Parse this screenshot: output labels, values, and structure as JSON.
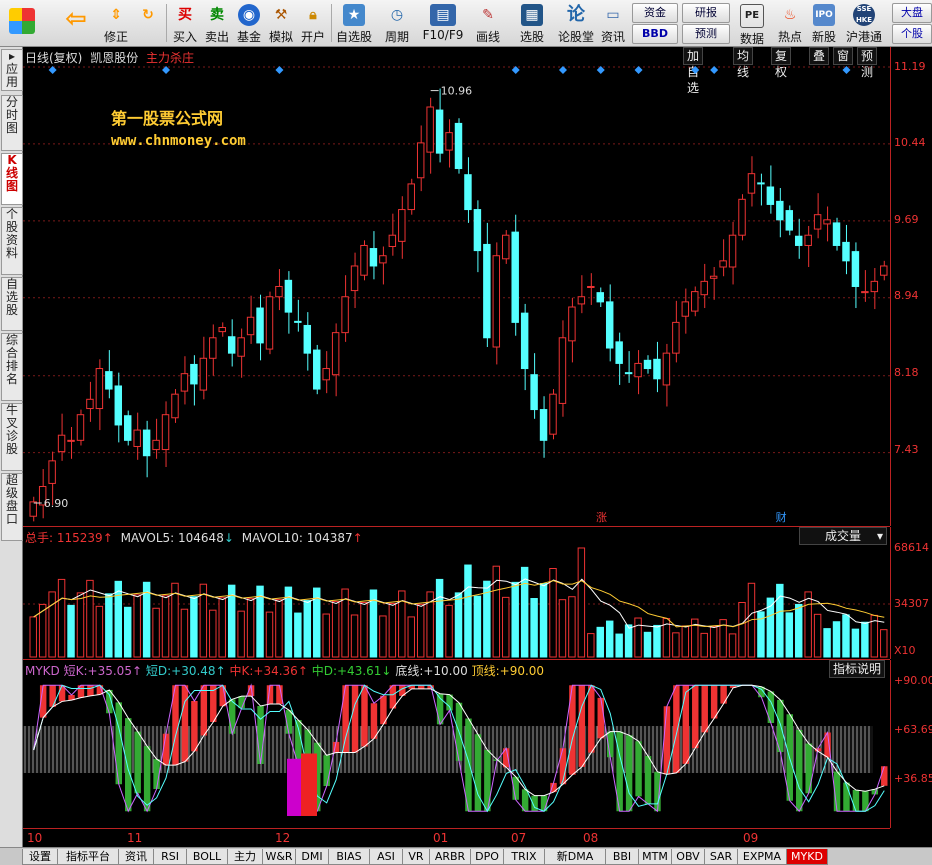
{
  "toolbar": {
    "buttons": [
      {
        "label": "",
        "icon": "windows-icon"
      },
      {
        "label": "",
        "icon": "back-arrow-icon"
      },
      {
        "label": "修正",
        "icon": "updown-icon"
      },
      {
        "label": "",
        "icon": "refresh-icon"
      },
      {
        "label": "买入",
        "icon": "buy-icon"
      },
      {
        "label": "卖出",
        "icon": "sell-icon"
      },
      {
        "label": "基金",
        "icon": "fund-icon"
      },
      {
        "label": "模拟",
        "icon": "hammer-icon"
      },
      {
        "label": "开户",
        "icon": "lock-icon"
      },
      {
        "label": "自选股",
        "icon": "star-icon"
      },
      {
        "label": "周期",
        "icon": "clock-icon"
      },
      {
        "label": "F10/F9",
        "icon": "f10-icon"
      },
      {
        "label": "画线",
        "icon": "pen-icon"
      },
      {
        "label": "选股",
        "icon": "screen-icon"
      },
      {
        "label": "论股堂",
        "icon": "forum-icon"
      },
      {
        "label": "资讯",
        "icon": "info-icon"
      },
      {
        "label": "数据",
        "icon": "pe-icon"
      },
      {
        "label": "热点",
        "icon": "hot-icon"
      },
      {
        "label": "新股",
        "icon": "ipo-icon"
      },
      {
        "label": "沪港通",
        "icon": "sse-hke-icon"
      }
    ],
    "small_buttons": {
      "zijin": "资金",
      "bbd": "BBD",
      "yanbao": "研报",
      "yuce": "预测",
      "dapan": "大盘",
      "gegu": "个股"
    },
    "sse_text": "SSE HKE"
  },
  "left_tabs": [
    "应用",
    "分时图",
    "K线图",
    "个股资料",
    "自选股",
    "综合排名",
    "牛叉诊股",
    "超级盘口"
  ],
  "price_panel": {
    "title": "日线(复权)",
    "stock": "凯恩股份",
    "indicator": "主力杀庄",
    "right_buttons": [
      "加自选",
      "均线",
      "复权",
      "叠",
      "窗",
      "预测"
    ],
    "high_label": "10.96",
    "low_label": "6.90",
    "markers": [
      "涨",
      "财"
    ],
    "watermark_title": "第一股票公式网",
    "watermark_url": "www.chnmoney.com",
    "axis": [
      "11.19",
      "10.44",
      "9.69",
      "8.94",
      "8.18",
      "7.43"
    ]
  },
  "volume_panel": {
    "label": "总手:",
    "value": "115239",
    "mavol5_label": "MAVOL5:",
    "mavol5": "104648",
    "mavol10_label": "MAVOL10:",
    "mavol10": "104387",
    "dropdown": "成交量",
    "axis": [
      "68614",
      "34307",
      "X10"
    ]
  },
  "indicator_panel": {
    "name": "MYKD",
    "shortk_label": "短K:",
    "shortk": "+35.05",
    "shortd_label": "短D:",
    "shortd": "+30.48",
    "midk_label": "中K:",
    "midk": "+34.36",
    "midd_label": "中D:",
    "midd": "+43.61",
    "bottom_label": "底线:",
    "bottom": "+10.00",
    "top_label": "顶线:",
    "top": "+90.00",
    "help": "指标说明",
    "axis": [
      "+90.00",
      "+63.69",
      "+36.85"
    ]
  },
  "x_axis": [
    "10",
    "11",
    "12",
    "01",
    "07",
    "08",
    "09"
  ],
  "bottom_tabs": [
    "设置",
    "指标平台",
    "资讯",
    "RSI",
    "BOLL",
    "主力",
    "W&R",
    "DMI",
    "BIAS",
    "ASI",
    "VR",
    "ARBR",
    "DPO",
    "TRIX",
    "新DMA",
    "BBI",
    "MTM",
    "OBV",
    "SAR",
    "EXPMA",
    "MYKD"
  ],
  "chart_data": {
    "type": "candlestick",
    "price_range": [
      6.9,
      11.19
    ],
    "closes": [
      6.95,
      7.1,
      7.35,
      7.6,
      7.55,
      7.8,
      7.95,
      8.25,
      8.05,
      7.7,
      7.55,
      7.65,
      7.4,
      7.55,
      7.8,
      8.0,
      8.2,
      8.1,
      8.35,
      8.55,
      8.65,
      8.4,
      8.55,
      8.75,
      8.5,
      8.95,
      9.05,
      8.8,
      8.7,
      8.4,
      8.05,
      8.25,
      8.6,
      8.95,
      9.25,
      9.45,
      9.25,
      9.35,
      9.55,
      9.8,
      10.05,
      10.45,
      10.8,
      10.35,
      10.55,
      10.2,
      9.8,
      9.4,
      8.55,
      9.35,
      9.55,
      8.7,
      8.25,
      7.85,
      7.55,
      8.0,
      8.55,
      8.85,
      8.95,
      9.05,
      8.9,
      8.45,
      8.3,
      8.2,
      8.3,
      8.25,
      8.15,
      8.4,
      8.7,
      8.9,
      9.0,
      9.1,
      9.15,
      9.3,
      9.55,
      9.9,
      10.15,
      10.05,
      9.85,
      9.7,
      9.6,
      9.45,
      9.55,
      9.75,
      9.7,
      9.45,
      9.3,
      9.05,
      9.0,
      9.1,
      9.25
    ]
  }
}
